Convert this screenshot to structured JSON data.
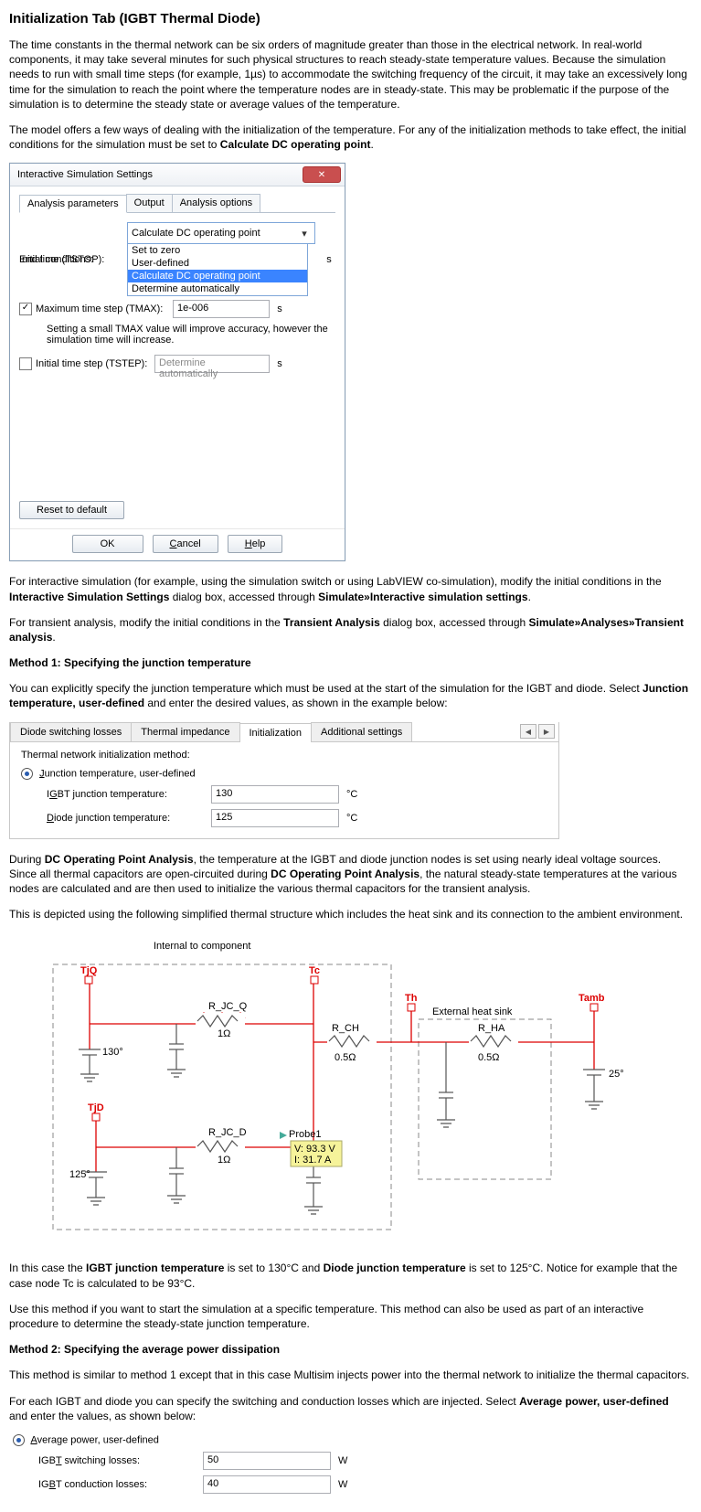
{
  "title": "Initialization Tab (IGBT Thermal Diode)",
  "para1": "The time constants in the thermal network can be six orders of magnitude greater than those in the electrical network. In real-world components, it may take several minutes for such physical structures to reach steady-state temperature values. Because the simulation needs to run with small time steps (for example, 1µs) to accommodate the switching frequency of the circuit, it may take an excessively long time for the simulation to reach the point where the temperature nodes are in steady-state. This may be problematic if the purpose of the simulation is to determine the steady state or average values of the temperature.",
  "para2a": "The model offers a few ways of dealing with the initialization of the temperature. For any of the initialization methods to take effect, the initial conditions for the simulation must be set to ",
  "para2b": "Calculate DC operating point",
  "dialog": {
    "title": "Interactive Simulation Settings",
    "tabs": [
      "Analysis parameters",
      "Output",
      "Analysis options"
    ],
    "initial_conditions_label": "Initial conditions:",
    "initial_conditions_value": "Calculate DC operating point",
    "dropdown_options": [
      "Set to zero",
      "User-defined",
      "Calculate DC operating point",
      "Determine automatically"
    ],
    "end_time_label": "End time (TSTOP):",
    "end_time_unit": "s",
    "tmax_checkbox_label": "Maximum time step (TMAX):",
    "tmax_value": "1e-006",
    "tmax_unit": "s",
    "tmax_note": "Setting a small TMAX value will improve accuracy, however the simulation time will increase.",
    "tstep_checkbox_label": "Initial time step (TSTEP):",
    "tstep_value": "Determine automatically",
    "tstep_unit": "s",
    "reset": "Reset to default",
    "ok": "OK",
    "cancel": "Cancel",
    "help": "Help"
  },
  "para3a": "For interactive simulation (for example, using the simulation switch or using LabVIEW co-simulation), modify the initial conditions in the ",
  "para3b": "Interactive Simulation Settings",
  "para3c": " dialog box, accessed through ",
  "para3d": "Simulate»Interactive simulation settings",
  "para4a": "For transient analysis, modify the initial conditions in the ",
  "para4b": "Transient Analysis",
  "para4c": " dialog box, accessed through ",
  "para4d": "Simulate»Analyses»Transient analysis",
  "method1_heading": "Method 1: Specifying the junction temperature",
  "method1_para_a": "You can explicitly specify the junction temperature which must be used at the start of the simulation for the IGBT and diode. Select ",
  "method1_para_b": "Junction temperature, user-defined",
  "method1_para_c": " and enter the desired values, as shown in the example below:",
  "init_tabs": [
    "Diode switching losses",
    "Thermal impedance",
    "Initialization",
    "Additional settings"
  ],
  "init_panel": {
    "method_label": "Thermal network initialization method:",
    "radio_label": "Junction temperature, user-defined",
    "igbt_label": "IGBT junction temperature:",
    "igbt_value": "130",
    "diode_label": "Diode junction temperature:",
    "diode_value": "125",
    "unit": "°C"
  },
  "para5a": "During ",
  "para5b": "DC Operating Point Analysis",
  "para5c": ", the temperature at the IGBT and diode junction nodes is set using nearly ideal voltage sources. Since all thermal capacitors are open-circuited during ",
  "para5d": "DC Operating Point Analysis",
  "para5e": ", the natural steady-state temperatures at the various nodes are calculated and are then used to initialize the various thermal capacitors for the transient analysis.",
  "para6": "This is depicted using the following simplified thermal structure which includes the heat sink and its connection to the ambient environment.",
  "circuit": {
    "internal_label": "Internal to component",
    "external_label": "External heat sink",
    "nodes": {
      "tjq": "TjQ",
      "tjd": "TjD",
      "tc": "Tc",
      "th": "Th",
      "tamb": "Tamb"
    },
    "rjcq": "R_JC_Q",
    "rjcq_val": "1Ω",
    "rjcd": "R_JC_D",
    "rjcd_val": "1Ω",
    "rch": "R_CH",
    "rch_val": "0.5Ω",
    "rha": "R_HA",
    "rha_val": "0.5Ω",
    "v130": "130°",
    "v125": "125°",
    "v25": "25°",
    "probe_name": "Probe1",
    "probe_v": "V: 93.3 V",
    "probe_i": "I: 31.7 A"
  },
  "para7a": "In this case the ",
  "para7b": "IGBT junction temperature",
  "para7c": " is set to 130°C and ",
  "para7d": "Diode junction temperature",
  "para7e": " is set to 125°C. Notice for example that the case node Tc is calculated to be 93°C.",
  "para8": "Use this method if you want to start the simulation at a specific temperature. This method can also be used as part of an interactive procedure to determine the steady-state junction temperature.",
  "method2_heading": "Method 2: Specifying the average power dissipation",
  "method2_para1": "This method is similar to method 1 except that in this case Multisim injects power into the thermal network to initialize the thermal capacitors.",
  "method2_para2a": "For each IGBT and diode you can specify the switching and conduction losses which are injected. Select ",
  "method2_para2b": "Average power, user-defined",
  "method2_para2c": " and enter the values, as shown below:",
  "method2_panel": {
    "radio_label": "Average power, user-defined",
    "sw_label": "IGBT switching losses:",
    "sw_value": "50",
    "cond_label": "IGBT conduction losses:",
    "cond_value": "40",
    "unit": "W"
  }
}
